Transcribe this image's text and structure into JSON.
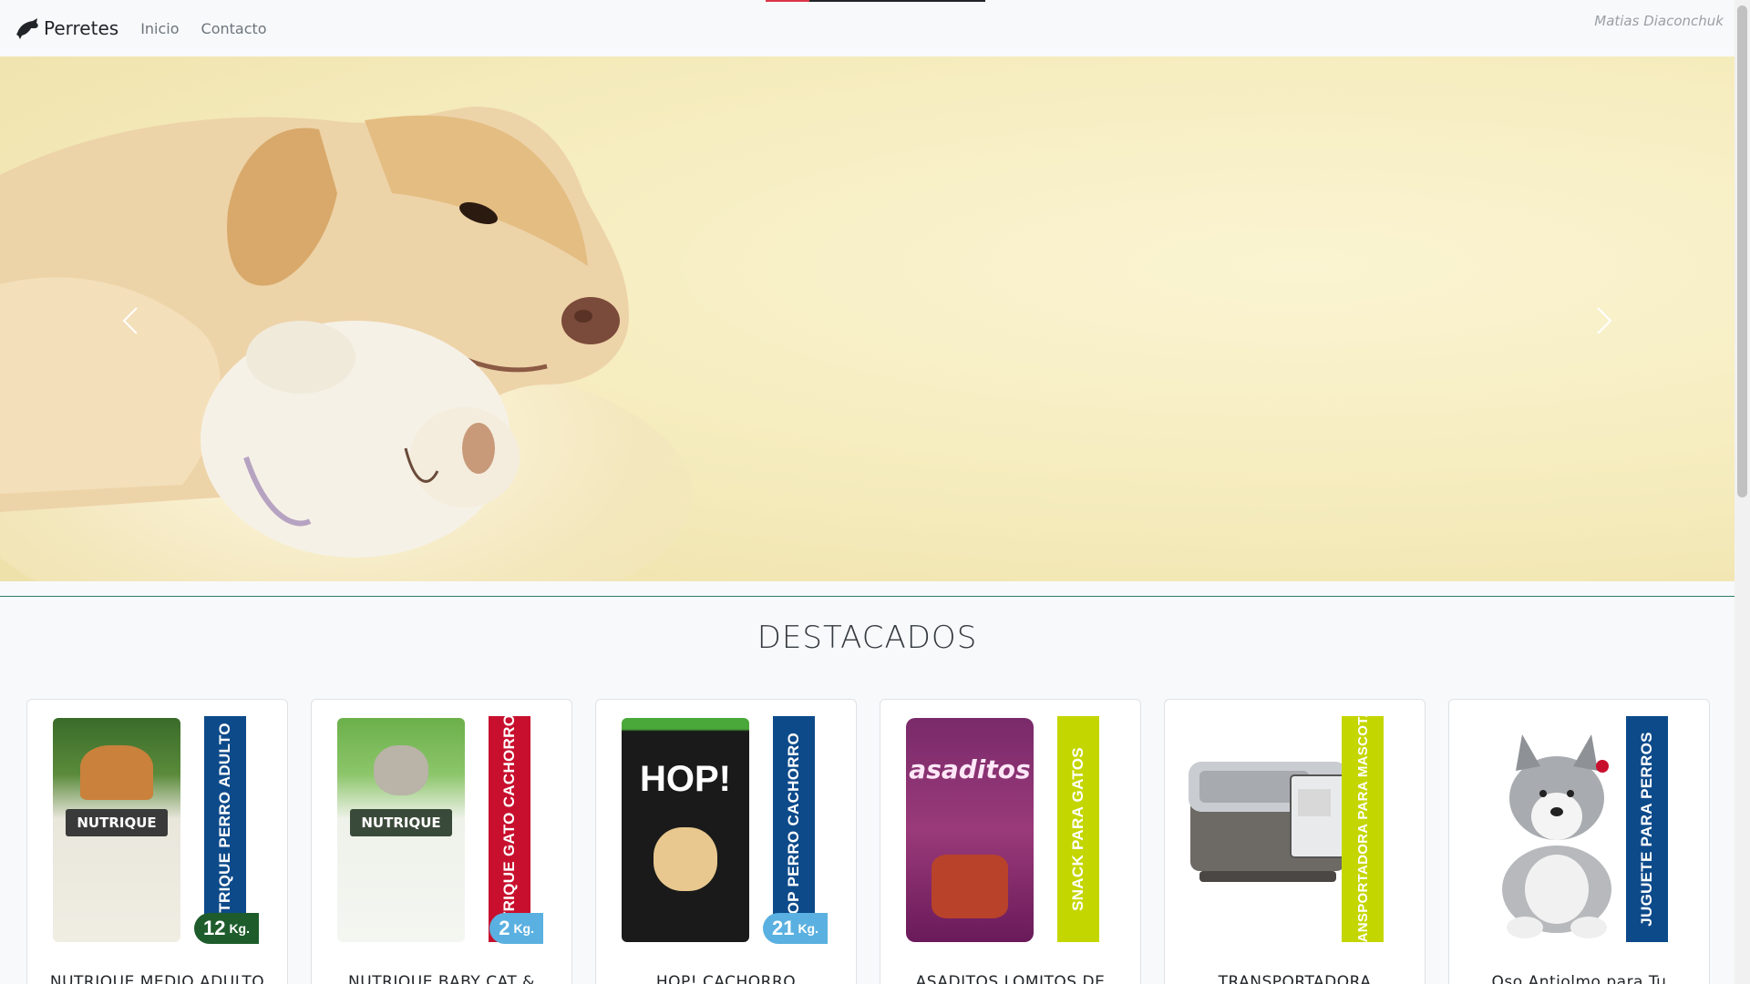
{
  "navbar": {
    "brand": "Perretes",
    "links": [
      "Inicio",
      "Contacto"
    ],
    "author": "Matias Diaconchuk"
  },
  "scroll_progress": 0.2,
  "carousel": {
    "prev_icon": "chevron-left-icon",
    "next_icon": "chevron-right-icon"
  },
  "section": {
    "title": "DESTACADOS"
  },
  "products": [
    {
      "title": "NUTRIQUE MEDIO ADULTO",
      "band": "NUTRIQUE PERRO ADULTO",
      "band_color": "#0d4a8a",
      "kg": "12",
      "kg_color": "#1f5c2c",
      "bag_brand": "NUTRIQUE"
    },
    {
      "title": "NUTRIQUE BABY CAT &",
      "band": "NUTRIQUE GATO CACHORRO",
      "band_color": "#c8102e",
      "kg": "2",
      "kg_color": "#5ab0e0",
      "bag_brand": "NUTRIQUE"
    },
    {
      "title": "HOP! CACHORRO",
      "band": "HOP PERRO CACHORRO",
      "band_color": "#0d4a8a",
      "kg": "21",
      "kg_color": "#5ab0e0",
      "bag_brand": "HOP!"
    },
    {
      "title": "ASADITOS LOMITOS DE",
      "band": "SNACK PARA GATOS",
      "band_color": "#c4d600",
      "bag_brand": "asaditos"
    },
    {
      "title": "TRANSPORTADORA",
      "band": "TRANSPORTADORA PARA MASCOTAS",
      "band_color": "#c4d600"
    },
    {
      "title": "Oso Antiolmo para Tu",
      "band": "JUGUETE PARA PERROS",
      "band_color": "#0d4a8a"
    }
  ],
  "kg_unit": "Kg."
}
